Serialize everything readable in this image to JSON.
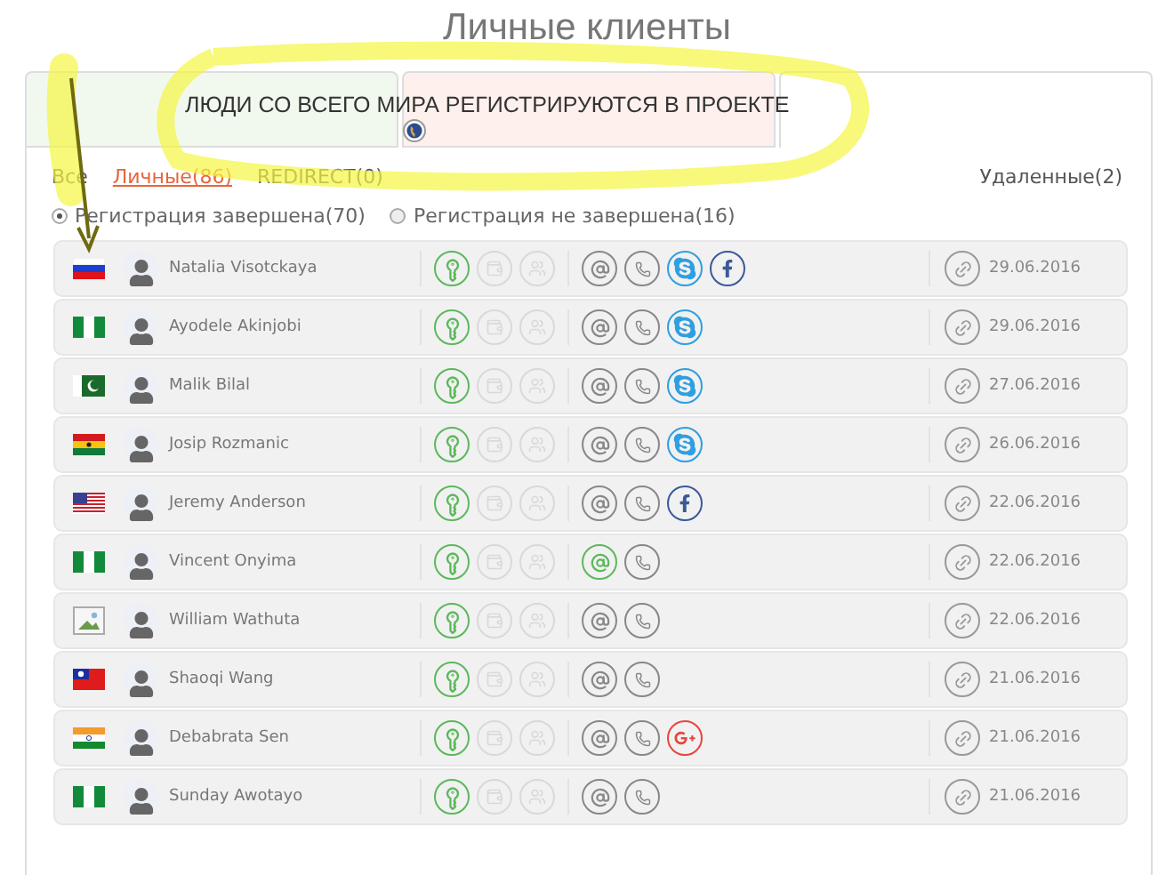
{
  "page_title": "Личные клиенты",
  "tabs": [
    {
      "selected": false,
      "color": "#f1f9ee"
    },
    {
      "selected": false,
      "color": "#fdf0ed"
    },
    {
      "selected": true,
      "color": "#ffffff"
    }
  ],
  "banner": {
    "text": "ЛЮДИ СО ВСЕГО МИРА РЕГИСТРИРУЮТСЯ В ПРОЕКТЕ"
  },
  "filters": [
    {
      "label": "Все",
      "selected": false
    },
    {
      "label": "Личные(86)",
      "selected": true
    },
    {
      "label": "REDIRECT(0)",
      "selected": false
    },
    {
      "label": "Удаленные(2)",
      "selected": false
    }
  ],
  "radios": [
    {
      "label": "Регистрация завершена(70)",
      "selected": true
    },
    {
      "label": "Регистрация не завершена(16)",
      "selected": false
    }
  ],
  "clients": [
    {
      "flag": {
        "kind": "ru"
      },
      "name": "Natalia Visotckaya",
      "services": [
        {
          "kind": "key",
          "active": true
        },
        {
          "kind": "wallet",
          "active": false
        },
        {
          "kind": "group",
          "active": false
        }
      ],
      "contacts": [
        {
          "kind": "email",
          "active": false
        },
        {
          "kind": "phone",
          "active": false
        },
        {
          "kind": "skype",
          "active": true
        },
        {
          "kind": "facebook",
          "active": true
        }
      ],
      "date": "29.06.2016"
    },
    {
      "flag": {
        "kind": "ng"
      },
      "name": "Ayodele Akinjobi",
      "services": [
        {
          "kind": "key",
          "active": true
        },
        {
          "kind": "wallet",
          "active": false
        },
        {
          "kind": "group",
          "active": false
        }
      ],
      "contacts": [
        {
          "kind": "email",
          "active": false
        },
        {
          "kind": "phone",
          "active": false
        },
        {
          "kind": "skype",
          "active": true
        }
      ],
      "date": "29.06.2016"
    },
    {
      "flag": {
        "kind": "pk"
      },
      "name": "Malik Bilal",
      "services": [
        {
          "kind": "key",
          "active": true
        },
        {
          "kind": "wallet",
          "active": false
        },
        {
          "kind": "group",
          "active": false
        }
      ],
      "contacts": [
        {
          "kind": "email",
          "active": false
        },
        {
          "kind": "phone",
          "active": false
        },
        {
          "kind": "skype",
          "active": true
        }
      ],
      "date": "27.06.2016"
    },
    {
      "flag": {
        "kind": "gh"
      },
      "name": "Josip Rozmanic",
      "services": [
        {
          "kind": "key",
          "active": true
        },
        {
          "kind": "wallet",
          "active": false
        },
        {
          "kind": "group",
          "active": false
        }
      ],
      "contacts": [
        {
          "kind": "email",
          "active": false
        },
        {
          "kind": "phone",
          "active": false
        },
        {
          "kind": "skype",
          "active": true
        }
      ],
      "date": "26.06.2016"
    },
    {
      "flag": {
        "kind": "us"
      },
      "name": "Jeremy Anderson",
      "services": [
        {
          "kind": "key",
          "active": true
        },
        {
          "kind": "wallet",
          "active": false
        },
        {
          "kind": "group",
          "active": false
        }
      ],
      "contacts": [
        {
          "kind": "email",
          "active": false
        },
        {
          "kind": "phone",
          "active": false
        },
        {
          "kind": "facebook",
          "active": true
        }
      ],
      "date": "22.06.2016"
    },
    {
      "flag": {
        "kind": "ng"
      },
      "name": "Vincent Onyima",
      "services": [
        {
          "kind": "key",
          "active": true
        },
        {
          "kind": "wallet",
          "active": false
        },
        {
          "kind": "group",
          "active": false
        }
      ],
      "contacts": [
        {
          "kind": "email",
          "active": true
        },
        {
          "kind": "phone",
          "active": false
        }
      ],
      "date": "22.06.2016"
    },
    {
      "flag": {
        "kind": "missing"
      },
      "name": "William Wathuta",
      "services": [
        {
          "kind": "key",
          "active": true
        },
        {
          "kind": "wallet",
          "active": false
        },
        {
          "kind": "group",
          "active": false
        }
      ],
      "contacts": [
        {
          "kind": "email",
          "active": false
        },
        {
          "kind": "phone",
          "active": false
        }
      ],
      "date": "22.06.2016"
    },
    {
      "flag": {
        "kind": "tw"
      },
      "name": "Shaoqi Wang",
      "services": [
        {
          "kind": "key",
          "active": true
        },
        {
          "kind": "wallet",
          "active": false
        },
        {
          "kind": "group",
          "active": false
        }
      ],
      "contacts": [
        {
          "kind": "email",
          "active": false
        },
        {
          "kind": "phone",
          "active": false
        }
      ],
      "date": "21.06.2016"
    },
    {
      "flag": {
        "kind": "in"
      },
      "name": "Debabrata Sen",
      "services": [
        {
          "kind": "key",
          "active": true
        },
        {
          "kind": "wallet",
          "active": false
        },
        {
          "kind": "group",
          "active": false
        }
      ],
      "contacts": [
        {
          "kind": "email",
          "active": false
        },
        {
          "kind": "phone",
          "active": false
        },
        {
          "kind": "googleplus",
          "active": true
        }
      ],
      "date": "21.06.2016"
    },
    {
      "flag": {
        "kind": "ng"
      },
      "name": "Sunday Awotayo",
      "services": [
        {
          "kind": "key",
          "active": true
        },
        {
          "kind": "wallet",
          "active": false
        },
        {
          "kind": "group",
          "active": false
        }
      ],
      "contacts": [
        {
          "kind": "email",
          "active": false
        },
        {
          "kind": "phone",
          "active": false
        }
      ],
      "date": "21.06.2016"
    }
  ]
}
